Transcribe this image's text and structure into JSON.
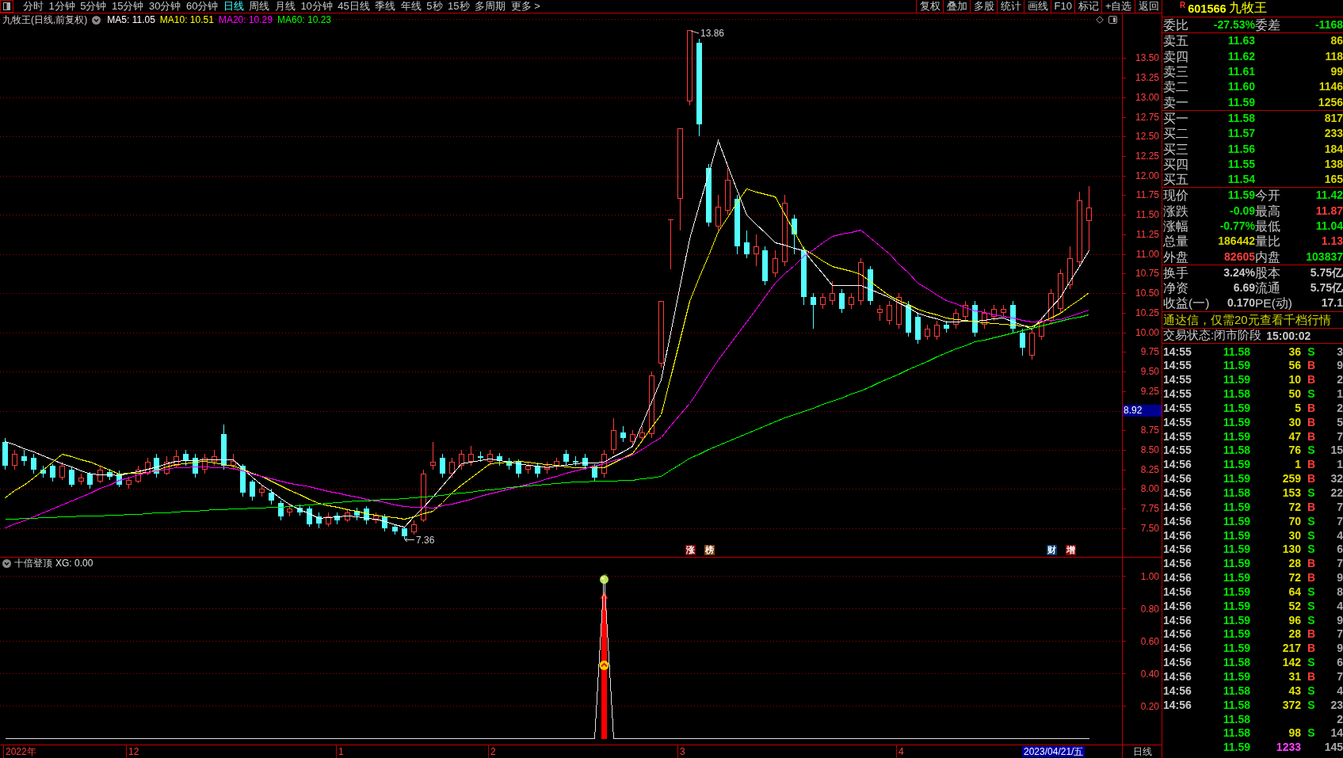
{
  "toolbar": {
    "periods": [
      {
        "label": "分时",
        "selected": false
      },
      {
        "label": "1分钟",
        "selected": false
      },
      {
        "label": "5分钟",
        "selected": false
      },
      {
        "label": "15分钟",
        "selected": false
      },
      {
        "label": "30分钟",
        "selected": false
      },
      {
        "label": "60分钟",
        "selected": false
      },
      {
        "label": "日线",
        "selected": true
      },
      {
        "label": "周线",
        "selected": false
      },
      {
        "label": "月线",
        "selected": false
      },
      {
        "label": "10分钟",
        "selected": false
      },
      {
        "label": "45日线",
        "selected": false
      },
      {
        "label": "季线",
        "selected": false
      },
      {
        "label": "年线",
        "selected": false
      },
      {
        "label": "5秒",
        "selected": false
      },
      {
        "label": "15秒",
        "selected": false
      },
      {
        "label": "多周期",
        "selected": false
      },
      {
        "label": "更多 >",
        "selected": false
      }
    ],
    "buttons": [
      "复权",
      "叠加",
      "多股",
      "统计",
      "画线",
      "F10",
      "标记",
      "+自选",
      "返回"
    ]
  },
  "chart": {
    "title": "九牧王(日线,前复权)",
    "legend_values": [
      ": 11.05",
      ": 10.51",
      ": 10.29",
      ": 10.23"
    ],
    "high_label": "13.86",
    "low_label": "7.36",
    "cursor_price": "8.92",
    "events": [
      {
        "label": "涨",
        "color": "#800000"
      },
      {
        "label": "榜",
        "color": "#804010"
      },
      {
        "label": "财",
        "color": "#003a70"
      },
      {
        "label": "增",
        "color": "#900000"
      }
    ],
    "chart_data": {
      "type": "candlestick",
      "grid": true,
      "categories": [
        null,
        null,
        null,
        null,
        null,
        null,
        null,
        null,
        null,
        null,
        null,
        null,
        null,
        null,
        null,
        null,
        null,
        null,
        null,
        null,
        null,
        null,
        null,
        null,
        null,
        null,
        null,
        null,
        null,
        null,
        null,
        null,
        null,
        null,
        null,
        null,
        null,
        null,
        null,
        null,
        null,
        null,
        null,
        null,
        null,
        null,
        null,
        null,
        null,
        null,
        null,
        null,
        null,
        null,
        null,
        null,
        null,
        null,
        null,
        null,
        null,
        null,
        null,
        null,
        null,
        null,
        null,
        null,
        null,
        null,
        null,
        null,
        null,
        null,
        null,
        null,
        null,
        null,
        null,
        null,
        null,
        null,
        null,
        null,
        null,
        null,
        null,
        null,
        null,
        null,
        null,
        null,
        null,
        null,
        null,
        null,
        null,
        null,
        null,
        null,
        null,
        null,
        null,
        null,
        null,
        null,
        null,
        null,
        null,
        null,
        null,
        null,
        null,
        null,
        null,
        null,
        null,
        null
      ],
      "ylim": [
        7.135,
        14.07
      ],
      "yticks": [
        {
          "value": 13.5,
          "label": "13.50"
        },
        {
          "value": 13.25,
          "label": "13.25"
        },
        {
          "value": 13,
          "label": "13.00"
        },
        {
          "value": 12.75,
          "label": "12.75"
        },
        {
          "value": 12.5,
          "label": "12.50"
        },
        {
          "value": 12.25,
          "label": "12.25"
        },
        {
          "value": 12,
          "label": "12.00"
        },
        {
          "value": 11.75,
          "label": "11.75"
        },
        {
          "value": 11.5,
          "label": "11.50"
        },
        {
          "value": 11.25,
          "label": "11.25"
        },
        {
          "value": 11,
          "label": "11.00"
        },
        {
          "value": 10.75,
          "label": "10.75"
        },
        {
          "value": 10.5,
          "label": "10.50"
        },
        {
          "value": 10.25,
          "label": "10.25"
        },
        {
          "value": 10,
          "label": "10.00"
        },
        {
          "value": 9.75,
          "label": "9.75"
        },
        {
          "value": 9.5,
          "label": "9.50"
        },
        {
          "value": 9.25,
          "label": "9.25"
        },
        {
          "value": 8.75,
          "label": "8.75"
        },
        {
          "value": 8.5,
          "label": "8.50"
        },
        {
          "value": 8.25,
          "label": "8.25"
        },
        {
          "value": 8,
          "label": "8.00"
        },
        {
          "value": 7.75,
          "label": "7.75"
        },
        {
          "value": 7.5,
          "label": "7.50"
        }
      ],
      "ohlc": [
        [
          8.6,
          8.65,
          8.25,
          8.3
        ],
        [
          8.3,
          8.5,
          8.25,
          8.45
        ],
        [
          8.42,
          8.5,
          8.3,
          8.36
        ],
        [
          8.4,
          8.45,
          8.2,
          8.25
        ],
        [
          8.25,
          8.3,
          8.15,
          8.2
        ],
        [
          8.3,
          8.32,
          8.1,
          8.15
        ],
        [
          8.15,
          8.35,
          8.12,
          8.3
        ],
        [
          8.25,
          8.28,
          8.02,
          8.05
        ],
        [
          8.1,
          8.2,
          8.05,
          8.15
        ],
        [
          8.2,
          8.22,
          8.0,
          8.05
        ],
        [
          8.1,
          8.3,
          8.08,
          8.25
        ],
        [
          8.22,
          8.26,
          8.12,
          8.16
        ],
        [
          8.2,
          8.24,
          8.02,
          8.05
        ],
        [
          8.05,
          8.16,
          8.0,
          8.12
        ],
        [
          8.1,
          8.3,
          8.08,
          8.25
        ],
        [
          8.2,
          8.4,
          8.18,
          8.35
        ],
        [
          8.4,
          8.45,
          8.15,
          8.2
        ],
        [
          8.2,
          8.42,
          8.18,
          8.35
        ],
        [
          8.3,
          8.5,
          8.28,
          8.42
        ],
        [
          8.45,
          8.5,
          8.3,
          8.36
        ],
        [
          8.4,
          8.45,
          8.15,
          8.2
        ],
        [
          8.25,
          8.45,
          8.2,
          8.4
        ],
        [
          8.35,
          8.5,
          8.3,
          8.42
        ],
        [
          8.7,
          8.82,
          8.25,
          8.3
        ],
        [
          8.3,
          8.45,
          8.25,
          8.36
        ],
        [
          8.3,
          8.32,
          7.9,
          7.95
        ],
        [
          8.1,
          8.12,
          7.85,
          7.9
        ],
        [
          7.95,
          8.05,
          7.9,
          8.0
        ],
        [
          7.95,
          8.0,
          7.8,
          7.85
        ],
        [
          7.82,
          7.85,
          7.6,
          7.65
        ],
        [
          7.7,
          7.8,
          7.65,
          7.75
        ],
        [
          7.76,
          7.8,
          7.66,
          7.7
        ],
        [
          7.75,
          7.78,
          7.52,
          7.55
        ],
        [
          7.65,
          7.7,
          7.5,
          7.56
        ],
        [
          7.55,
          7.7,
          7.52,
          7.65
        ],
        [
          7.66,
          7.7,
          7.55,
          7.6
        ],
        [
          7.6,
          7.75,
          7.58,
          7.7
        ],
        [
          7.72,
          7.76,
          7.6,
          7.66
        ],
        [
          7.75,
          7.78,
          7.55,
          7.6
        ],
        [
          7.6,
          7.7,
          7.56,
          7.66
        ],
        [
          7.65,
          7.68,
          7.46,
          7.5
        ],
        [
          7.52,
          7.55,
          7.42,
          7.46
        ],
        [
          7.5,
          7.52,
          7.36,
          7.4
        ],
        [
          7.45,
          7.6,
          7.42,
          7.55
        ],
        [
          7.6,
          8.25,
          7.58,
          8.2
        ],
        [
          8.3,
          8.6,
          8.25,
          8.35
        ],
        [
          8.4,
          8.45,
          8.15,
          8.2
        ],
        [
          8.2,
          8.4,
          8.15,
          8.35
        ],
        [
          8.3,
          8.5,
          8.25,
          8.45
        ],
        [
          8.35,
          8.55,
          8.3,
          8.45
        ],
        [
          8.42,
          8.48,
          8.35,
          8.4
        ],
        [
          8.35,
          8.5,
          8.3,
          8.45
        ],
        [
          8.42,
          8.46,
          8.3,
          8.36
        ],
        [
          8.36,
          8.4,
          8.25,
          8.3
        ],
        [
          8.35,
          8.38,
          8.15,
          8.2
        ],
        [
          8.25,
          8.35,
          8.2,
          8.3
        ],
        [
          8.3,
          8.34,
          8.15,
          8.2
        ],
        [
          8.25,
          8.35,
          8.2,
          8.3
        ],
        [
          8.3,
          8.4,
          8.25,
          8.36
        ],
        [
          8.45,
          8.5,
          8.3,
          8.35
        ],
        [
          8.36,
          8.42,
          8.3,
          8.34
        ],
        [
          8.4,
          8.45,
          8.25,
          8.3
        ],
        [
          8.3,
          8.32,
          8.1,
          8.15
        ],
        [
          8.2,
          8.5,
          8.15,
          8.45
        ],
        [
          8.5,
          8.9,
          8.45,
          8.75
        ],
        [
          8.72,
          8.8,
          8.6,
          8.65
        ],
        [
          8.6,
          8.75,
          8.55,
          8.7
        ],
        [
          8.65,
          8.8,
          8.6,
          8.72
        ],
        [
          8.7,
          9.5,
          8.65,
          9.45
        ],
        [
          9.6,
          10.4,
          9.55,
          10.4
        ],
        [
          11.44,
          11.44,
          10.8,
          11.44
        ],
        [
          11.7,
          12.6,
          11.3,
          12.6
        ],
        [
          12.95,
          13.86,
          12.9,
          13.86
        ],
        [
          13.7,
          13.75,
          12.5,
          12.65
        ],
        [
          12.1,
          12.15,
          11.35,
          11.4
        ],
        [
          11.35,
          11.75,
          11.3,
          11.6
        ],
        [
          11.55,
          12.1,
          11.5,
          11.95
        ],
        [
          11.7,
          11.75,
          11.0,
          11.1
        ],
        [
          11.15,
          11.3,
          10.95,
          11.0
        ],
        [
          11.0,
          11.25,
          10.85,
          11.1
        ],
        [
          11.05,
          11.1,
          10.6,
          10.65
        ],
        [
          10.75,
          11.05,
          10.7,
          10.95
        ],
        [
          10.9,
          11.75,
          10.85,
          11.65
        ],
        [
          11.45,
          11.5,
          11.0,
          11.25
        ],
        [
          11.05,
          11.1,
          10.35,
          10.45
        ],
        [
          10.45,
          10.5,
          10.05,
          10.35
        ],
        [
          10.35,
          10.5,
          10.3,
          10.45
        ],
        [
          10.4,
          10.65,
          10.35,
          10.5
        ],
        [
          10.5,
          10.55,
          10.25,
          10.3
        ],
        [
          10.35,
          10.5,
          10.3,
          10.45
        ],
        [
          10.4,
          10.95,
          10.35,
          10.9
        ],
        [
          10.8,
          10.85,
          10.35,
          10.4
        ],
        [
          10.25,
          10.35,
          10.15,
          10.3
        ],
        [
          10.15,
          10.4,
          10.1,
          10.35
        ],
        [
          10.1,
          10.5,
          10.05,
          10.45
        ],
        [
          10.35,
          10.4,
          9.95,
          10.0
        ],
        [
          10.2,
          10.25,
          9.85,
          9.9
        ],
        [
          9.95,
          10.1,
          9.9,
          10.05
        ],
        [
          9.95,
          10.15,
          9.9,
          10.1
        ],
        [
          10.1,
          10.15,
          10.0,
          10.05
        ],
        [
          10.1,
          10.3,
          10.05,
          10.25
        ],
        [
          10.2,
          10.4,
          10.15,
          10.35
        ],
        [
          10.35,
          10.4,
          9.95,
          10.0
        ],
        [
          10.1,
          10.3,
          10.05,
          10.25
        ],
        [
          10.2,
          10.35,
          10.15,
          10.3
        ],
        [
          10.25,
          10.35,
          10.2,
          10.3
        ],
        [
          10.35,
          10.4,
          10.0,
          10.05
        ],
        [
          10.0,
          10.05,
          9.7,
          9.8
        ],
        [
          9.7,
          10.05,
          9.65,
          10.0
        ],
        [
          9.95,
          10.2,
          9.9,
          10.15
        ],
        [
          10.15,
          10.55,
          10.1,
          10.5
        ],
        [
          10.3,
          10.8,
          10.25,
          10.75
        ],
        [
          10.6,
          11.1,
          10.55,
          10.95
        ],
        [
          10.9,
          11.8,
          10.85,
          11.68
        ],
        [
          11.42,
          11.87,
          11.04,
          11.59
        ],
        null,
        null,
        null
      ],
      "series": [
        {
          "name": "MA5",
          "type": "line",
          "color": "#ffffff",
          "values": [
            8.61,
            8.57,
            8.52,
            8.48,
            8.43,
            8.38,
            8.33,
            8.29,
            8.24,
            8.2,
            8.19,
            8.19,
            8.18,
            8.21,
            8.23,
            8.26,
            8.29,
            8.33,
            8.36,
            8.37,
            8.37,
            8.38,
            8.38,
            8.38,
            8.38,
            8.27,
            8.16,
            8.05,
            7.97,
            7.88,
            7.8,
            7.74,
            7.69,
            7.63,
            7.64,
            7.65,
            7.66,
            7.65,
            7.63,
            7.62,
            7.59,
            7.55,
            7.52,
            7.65,
            7.77,
            7.9,
            8.04,
            8.19,
            8.33,
            8.35,
            8.37,
            8.39,
            8.37,
            8.35,
            8.33,
            8.31,
            8.3,
            8.28,
            8.3,
            8.31,
            8.33,
            8.34,
            8.34,
            8.35,
            8.42,
            8.48,
            8.55,
            8.83,
            9.12,
            9.4,
            10.0,
            10.6,
            11.2,
            11.62,
            12.03,
            12.45,
            12.13,
            11.82,
            11.5,
            11.38,
            11.27,
            11.15,
            11.12,
            11.08,
            11.05,
            10.9,
            10.75,
            10.6,
            10.6,
            10.6,
            10.6,
            10.55,
            10.5,
            10.45,
            10.38,
            10.32,
            10.25,
            10.21,
            10.18,
            10.14,
            10.14,
            10.15,
            10.15,
            10.16,
            10.18,
            10.19,
            10.14,
            10.1,
            10.05,
            10.18,
            10.32,
            10.45,
            10.65,
            10.85,
            11.05,
            null,
            null,
            null
          ]
        },
        {
          "name": "MA10",
          "type": "line",
          "color": "#ffff00",
          "values": [
            7.89,
            7.98,
            8.06,
            8.15,
            8.25,
            8.35,
            8.45,
            8.42,
            8.38,
            8.35,
            8.3,
            8.25,
            8.2,
            8.21,
            8.21,
            8.22,
            8.25,
            8.29,
            8.32,
            8.33,
            8.35,
            8.36,
            8.34,
            8.32,
            8.3,
            8.26,
            8.21,
            8.17,
            8.11,
            8.04,
            7.98,
            7.93,
            7.87,
            7.82,
            7.79,
            7.77,
            7.74,
            7.72,
            7.69,
            7.67,
            7.65,
            7.64,
            7.62,
            7.65,
            7.69,
            7.72,
            7.83,
            7.95,
            8.06,
            8.15,
            8.24,
            8.33,
            8.34,
            8.35,
            8.36,
            8.35,
            8.33,
            8.32,
            8.31,
            8.29,
            8.28,
            8.28,
            8.28,
            8.28,
            8.34,
            8.4,
            8.46,
            8.62,
            8.79,
            8.95,
            9.43,
            9.92,
            10.4,
            10.7,
            10.99,
            11.29,
            11.47,
            11.66,
            11.84,
            11.8,
            11.77,
            11.73,
            11.51,
            11.29,
            11.07,
            11.0,
            10.92,
            10.85,
            10.81,
            10.78,
            10.74,
            10.65,
            10.56,
            10.47,
            10.41,
            10.36,
            10.3,
            10.26,
            10.23,
            10.19,
            10.17,
            10.16,
            10.14,
            10.13,
            10.12,
            10.11,
            10.1,
            10.09,
            10.08,
            10.14,
            10.19,
            10.25,
            10.34,
            10.42,
            10.51,
            null,
            null,
            null
          ]
        },
        {
          "name": "MA20",
          "type": "line",
          "color": "#ff00ff",
          "values": [
            7.51,
            7.56,
            7.6,
            7.65,
            7.7,
            7.75,
            7.8,
            7.85,
            7.9,
            7.95,
            8.01,
            8.06,
            8.12,
            8.15,
            8.19,
            8.22,
            8.24,
            8.26,
            8.28,
            8.28,
            8.29,
            8.29,
            8.28,
            8.28,
            8.27,
            8.24,
            8.2,
            8.17,
            8.14,
            8.11,
            8.08,
            8.05,
            8.03,
            8.0,
            7.97,
            7.95,
            7.92,
            7.9,
            7.87,
            7.85,
            7.83,
            7.8,
            7.78,
            7.77,
            7.77,
            7.76,
            7.79,
            7.81,
            7.84,
            7.87,
            7.91,
            7.94,
            7.97,
            8.0,
            8.03,
            8.07,
            8.1,
            8.14,
            8.17,
            8.21,
            8.24,
            8.27,
            8.3,
            8.33,
            8.37,
            8.4,
            8.44,
            8.51,
            8.59,
            8.66,
            8.81,
            8.95,
            9.1,
            9.28,
            9.47,
            9.65,
            9.81,
            9.98,
            10.14,
            10.3,
            10.47,
            10.63,
            10.75,
            10.86,
            10.98,
            11.06,
            11.15,
            11.23,
            11.26,
            11.28,
            11.31,
            11.21,
            11.11,
            11.01,
            10.88,
            10.76,
            10.63,
            10.56,
            10.48,
            10.41,
            10.37,
            10.32,
            10.28,
            10.26,
            10.23,
            10.21,
            10.19,
            10.16,
            10.14,
            10.15,
            10.16,
            10.17,
            10.21,
            10.25,
            10.29,
            null,
            null,
            null
          ]
        },
        {
          "name": "MA60",
          "type": "line",
          "color": "#00ff00",
          "values": [
            7.62,
            7.62,
            7.63,
            7.63,
            7.64,
            7.64,
            7.65,
            7.65,
            7.66,
            7.66,
            7.66,
            7.67,
            7.67,
            7.68,
            7.68,
            7.69,
            7.7,
            7.7,
            7.71,
            7.72,
            7.72,
            7.73,
            7.74,
            7.74,
            7.75,
            7.75,
            7.76,
            7.76,
            7.77,
            7.77,
            7.78,
            7.79,
            7.8,
            7.81,
            7.82,
            7.83,
            7.84,
            7.85,
            7.85,
            7.86,
            7.87,
            7.87,
            7.88,
            7.89,
            7.9,
            7.91,
            7.92,
            7.94,
            7.95,
            7.96,
            7.98,
            7.99,
            8.0,
            8.02,
            8.03,
            8.04,
            8.06,
            8.07,
            8.08,
            8.09,
            8.1,
            8.1,
            8.11,
            8.11,
            8.11,
            8.12,
            8.12,
            8.14,
            8.15,
            8.17,
            8.25,
            8.32,
            8.4,
            8.45,
            8.51,
            8.56,
            8.61,
            8.66,
            8.71,
            8.76,
            8.81,
            8.86,
            8.91,
            8.95,
            9.0,
            9.04,
            9.09,
            9.13,
            9.17,
            9.22,
            9.26,
            9.31,
            9.37,
            9.42,
            9.47,
            9.53,
            9.58,
            9.63,
            9.69,
            9.74,
            9.79,
            9.83,
            9.88,
            9.91,
            9.94,
            9.97,
            10.0,
            10.03,
            10.06,
            10.09,
            10.12,
            10.15,
            10.18,
            10.2,
            10.23,
            null,
            null,
            null
          ]
        }
      ]
    }
  },
  "indicator": {
    "title": "十倍登顶",
    "reading": ": 0.00",
    "chart_data": {
      "type": "line",
      "grid": true,
      "categories": [
        null,
        null,
        null,
        null,
        null,
        null,
        null,
        null,
        null,
        null,
        null,
        null,
        null,
        null,
        null,
        null,
        null,
        null,
        null,
        null,
        null,
        null,
        null,
        null,
        null,
        null,
        null,
        null,
        null,
        null,
        null,
        null,
        null,
        null,
        null,
        null,
        null,
        null,
        null,
        null,
        null,
        null,
        null,
        null,
        null,
        null,
        null,
        null,
        null,
        null,
        null,
        null,
        null,
        null,
        null,
        null,
        null,
        null,
        null,
        null,
        null,
        null,
        null,
        null,
        null,
        null,
        null,
        null,
        null,
        null,
        null,
        null,
        null,
        null,
        null,
        null,
        null,
        null,
        null,
        null,
        null,
        null,
        null,
        null,
        null,
        null,
        null,
        null,
        null,
        null,
        null,
        null,
        null,
        null,
        null,
        null,
        null,
        null,
        null,
        null,
        null,
        null,
        null,
        null,
        null,
        null,
        null,
        null,
        null,
        null,
        null,
        null,
        null,
        null,
        null,
        null,
        null,
        null
      ],
      "ylim": [
        -0.1195,
        1.117
      ],
      "yticks": [
        {
          "value": 1,
          "label": "1.00"
        },
        {
          "value": 0.8,
          "label": "0.80"
        },
        {
          "value": 0.6,
          "label": "0.60"
        },
        {
          "value": 0.4,
          "label": "0.40"
        },
        {
          "value": 0.2,
          "label": "0.20"
        }
      ],
      "series": [
        {
          "name": "XG",
          "color": "#e0e0e0",
          "values": [
            0,
            0,
            0,
            0,
            0,
            0,
            0,
            0,
            0,
            0,
            0,
            0,
            0,
            0,
            0,
            0,
            0,
            0,
            0,
            0,
            0,
            0,
            0,
            0,
            0,
            0,
            0,
            0,
            0,
            0,
            0,
            0,
            0,
            0,
            0,
            0,
            0,
            0,
            0,
            0,
            0,
            0,
            0,
            0,
            0,
            0,
            0,
            0,
            0,
            0,
            0,
            0,
            0,
            0,
            0,
            0,
            0,
            0,
            0,
            0,
            0,
            0,
            0,
            1,
            0,
            0,
            0,
            0,
            0,
            0,
            0,
            0,
            0,
            0,
            0,
            0,
            0,
            0,
            0,
            0,
            0,
            0,
            0,
            0,
            0,
            0,
            0,
            0,
            0,
            0,
            0,
            0,
            0,
            0,
            0,
            0,
            0,
            0,
            0,
            0,
            0,
            0,
            0,
            0,
            0,
            0,
            0,
            0,
            0,
            0,
            0,
            0,
            0,
            0,
            0,
            null,
            null,
            null
          ]
        }
      ]
    }
  },
  "x_axis": {
    "labels": [
      "2022年",
      "12",
      "1",
      "2",
      "3",
      "4"
    ],
    "cursor_date": "2023/04/21/五",
    "period": "日线"
  },
  "quote": {
    "market_mark": "R",
    "code": "601566",
    "name": "九牧王",
    "blocks": [
      {
        "rows": [
          {
            "left": {
              "label": "委比",
              "value": "-27.53%",
              "color": "#00e600"
            },
            "right": {
              "label": "委差",
              "value": "-1168",
              "color": "#00e600"
            }
          }
        ]
      },
      {
        "rows": [
          {
            "left": {
              "label": "卖五",
              "value": "11.63",
              "color": "#00e600"
            },
            "right": {
              "value": "86",
              "color": "#d8d800"
            }
          },
          {
            "left": {
              "label": "卖四",
              "value": "11.62",
              "color": "#00e600"
            },
            "right": {
              "value": "118",
              "color": "#d8d800"
            }
          },
          {
            "left": {
              "label": "卖三",
              "value": "11.61",
              "color": "#00e600"
            },
            "right": {
              "value": "99",
              "color": "#d8d800"
            }
          },
          {
            "left": {
              "label": "卖二",
              "value": "11.60",
              "color": "#00e600"
            },
            "right": {
              "value": "1146",
              "color": "#d8d800"
            }
          },
          {
            "left": {
              "label": "卖一",
              "value": "11.59",
              "color": "#00e600"
            },
            "right": {
              "value": "1256",
              "color": "#d8d800"
            }
          }
        ]
      },
      {
        "rows": [
          {
            "left": {
              "label": "买一",
              "value": "11.58",
              "color": "#00e600"
            },
            "right": {
              "value": "817",
              "color": "#d8d800"
            }
          },
          {
            "left": {
              "label": "买二",
              "value": "11.57",
              "color": "#00e600"
            },
            "right": {
              "value": "233",
              "color": "#d8d800"
            }
          },
          {
            "left": {
              "label": "买三",
              "value": "11.56",
              "color": "#00e600"
            },
            "right": {
              "value": "184",
              "color": "#d8d800"
            }
          },
          {
            "left": {
              "label": "买四",
              "value": "11.55",
              "color": "#00e600"
            },
            "right": {
              "value": "138",
              "color": "#d8d800"
            }
          },
          {
            "left": {
              "label": "买五",
              "value": "11.54",
              "color": "#00e600"
            },
            "right": {
              "value": "165",
              "color": "#d8d800"
            }
          }
        ]
      },
      {
        "rows": [
          {
            "left": {
              "label": "现价",
              "value": "11.59",
              "color": "#00e600"
            },
            "right": {
              "label": "今开",
              "value": "11.42",
              "color": "#00e600"
            }
          },
          {
            "left": {
              "label": "涨跌",
              "value": "-0.09",
              "color": "#00e600"
            },
            "right": {
              "label": "最高",
              "value": "11.87",
              "color": "#ff3c3c"
            }
          },
          {
            "left": {
              "label": "涨幅",
              "value": "-0.77%",
              "color": "#00e600"
            },
            "right": {
              "label": "最低",
              "value": "11.04",
              "color": "#00e600"
            }
          },
          {
            "left": {
              "label": "总量",
              "value": "186442",
              "color": "#d8d800"
            },
            "right": {
              "label": "量比",
              "value": "1.13",
              "color": "#ff3c3c"
            }
          },
          {
            "left": {
              "label": "外盘",
              "value": "82605",
              "color": "#ff3c3c"
            },
            "right": {
              "label": "内盘",
              "value": "103837",
              "color": "#00e600"
            }
          }
        ]
      },
      {
        "rows": [
          {
            "left": {
              "label": "换手",
              "value": "3.24%",
              "color": "#c8c8c8"
            },
            "right": {
              "label": "股本",
              "value": "5.75亿",
              "color": "#c8c8c8"
            }
          },
          {
            "left": {
              "label": "净资",
              "value": "6.69",
              "color": "#c8c8c8"
            },
            "right": {
              "label": "流通",
              "value": "5.75亿",
              "color": "#c8c8c8"
            }
          },
          {
            "left": {
              "label": "收益(一)",
              "value": "0.170",
              "color": "#c8c8c8"
            },
            "right": {
              "label": "PE(动)",
              "value": "17.1",
              "color": "#c8c8c8"
            }
          }
        ]
      }
    ],
    "notice": "通达信，仅需20元查看千档行情",
    "status": {
      "label": "交易状态:闭市阶段",
      "time": "15:00:02"
    }
  },
  "ticks": [
    {
      "time": "14:55",
      "price": "11.58",
      "volume": "36",
      "side": "S",
      "count": "3",
      "kind": "sell"
    },
    {
      "time": "14:55",
      "price": "11.59",
      "volume": "56",
      "side": "B",
      "count": "9",
      "kind": "buy"
    },
    {
      "time": "14:55",
      "price": "11.59",
      "volume": "10",
      "side": "B",
      "count": "2",
      "kind": "buy"
    },
    {
      "time": "14:55",
      "price": "11.58",
      "volume": "50",
      "side": "S",
      "count": "1",
      "kind": "sell"
    },
    {
      "time": "14:55",
      "price": "11.59",
      "volume": "5",
      "side": "B",
      "count": "2",
      "kind": "buy"
    },
    {
      "time": "14:55",
      "price": "11.59",
      "volume": "30",
      "side": "B",
      "count": "5",
      "kind": "buy"
    },
    {
      "time": "14:55",
      "price": "11.59",
      "volume": "47",
      "side": "B",
      "count": "7",
      "kind": "buy"
    },
    {
      "time": "14:55",
      "price": "11.58",
      "volume": "76",
      "side": "S",
      "count": "15",
      "kind": "sell"
    },
    {
      "time": "14:56",
      "price": "11.59",
      "volume": "1",
      "side": "B",
      "count": "1",
      "kind": "buy"
    },
    {
      "time": "14:56",
      "price": "11.59",
      "volume": "259",
      "side": "B",
      "count": "32",
      "kind": "buy"
    },
    {
      "time": "14:56",
      "price": "11.58",
      "volume": "153",
      "side": "S",
      "count": "22",
      "kind": "sell"
    },
    {
      "time": "14:56",
      "price": "11.59",
      "volume": "72",
      "side": "B",
      "count": "7",
      "kind": "buy"
    },
    {
      "time": "14:56",
      "price": "11.59",
      "volume": "70",
      "side": "S",
      "count": "7",
      "kind": "sell"
    },
    {
      "time": "14:56",
      "price": "11.59",
      "volume": "30",
      "side": "S",
      "count": "4",
      "kind": "sell"
    },
    {
      "time": "14:56",
      "price": "11.59",
      "volume": "130",
      "side": "S",
      "count": "6",
      "kind": "sell"
    },
    {
      "time": "14:56",
      "price": "11.59",
      "volume": "28",
      "side": "B",
      "count": "7",
      "kind": "buy"
    },
    {
      "time": "14:56",
      "price": "11.59",
      "volume": "72",
      "side": "B",
      "count": "9",
      "kind": "buy"
    },
    {
      "time": "14:56",
      "price": "11.59",
      "volume": "64",
      "side": "S",
      "count": "8",
      "kind": "sell"
    },
    {
      "time": "14:56",
      "price": "11.59",
      "volume": "52",
      "side": "S",
      "count": "4",
      "kind": "sell"
    },
    {
      "time": "14:56",
      "price": "11.59",
      "volume": "96",
      "side": "S",
      "count": "9",
      "kind": "sell"
    },
    {
      "time": "14:56",
      "price": "11.59",
      "volume": "28",
      "side": "B",
      "count": "7",
      "kind": "buy"
    },
    {
      "time": "14:56",
      "price": "11.59",
      "volume": "217",
      "side": "B",
      "count": "9",
      "kind": "buy"
    },
    {
      "time": "14:56",
      "price": "11.58",
      "volume": "142",
      "side": "S",
      "count": "6",
      "kind": "sell"
    },
    {
      "time": "14:56",
      "price": "11.59",
      "volume": "31",
      "side": "B",
      "count": "7",
      "kind": "buy"
    },
    {
      "time": "14:56",
      "price": "11.58",
      "volume": "43",
      "side": "S",
      "count": "4",
      "kind": "sell"
    },
    {
      "time": "14:56",
      "price": "11.58",
      "volume": "372",
      "side": "S",
      "count": "23",
      "kind": "sell"
    },
    {
      "price": "11.58",
      "count": "2"
    },
    {
      "price": "11.58",
      "volume": "98",
      "side": "S",
      "count": "14",
      "kind": "sell"
    },
    {
      "price": "11.59",
      "volume": "1233",
      "count": "145",
      "kind": "auction"
    }
  ]
}
